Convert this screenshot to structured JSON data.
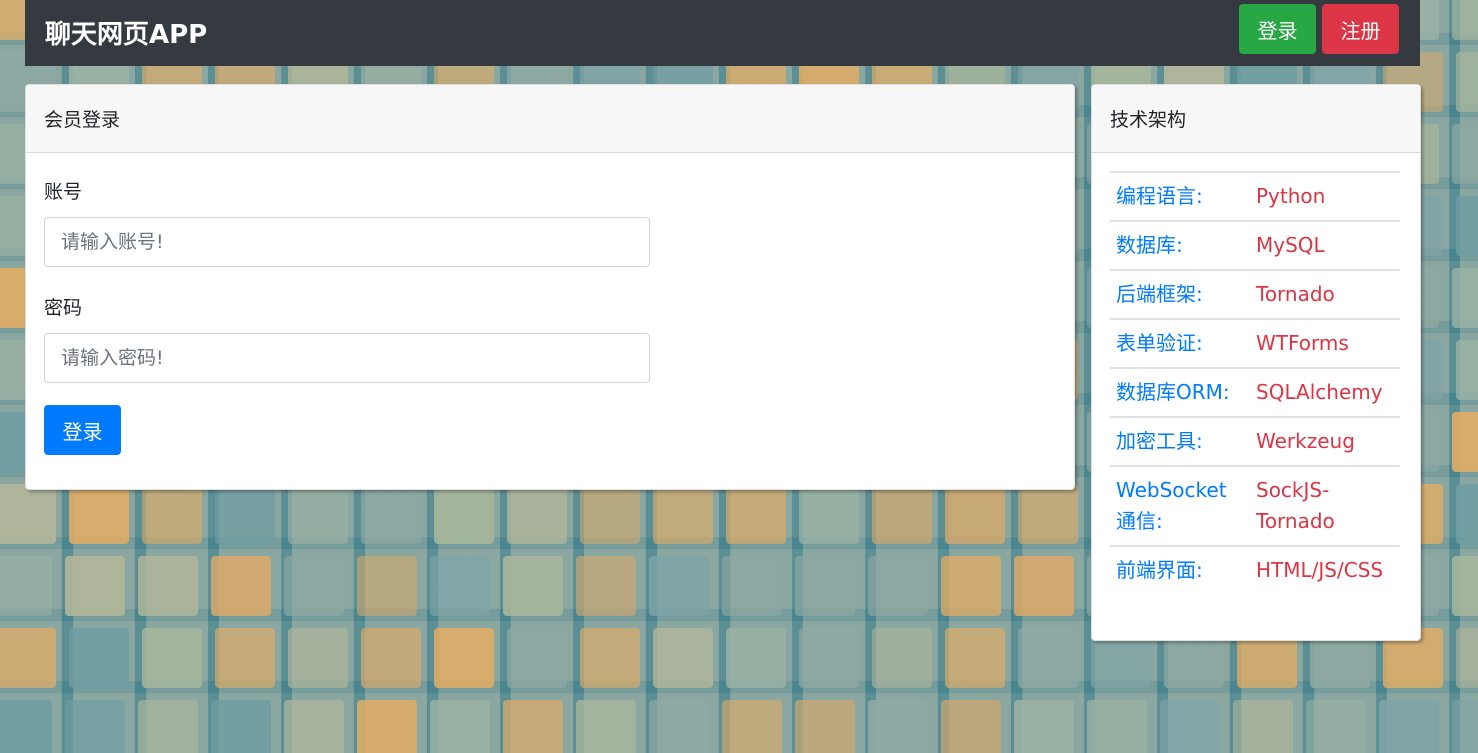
{
  "navbar": {
    "brand": "聊天网页APP",
    "login_label": "登录",
    "register_label": "注册"
  },
  "login_card": {
    "title": "会员登录",
    "account_label": "账号",
    "account_placeholder": "请输入账号!",
    "password_label": "密码",
    "password_placeholder": "请输入密码!",
    "submit_label": "登录"
  },
  "tech_card": {
    "title": "技术架构",
    "rows": [
      {
        "key": "编程语言:",
        "value": "Python"
      },
      {
        "key": "数据库:",
        "value": "MySQL"
      },
      {
        "key": "后端框架:",
        "value": "Tornado"
      },
      {
        "key": "表单验证:",
        "value": "WTForms"
      },
      {
        "key": "数据库ORM:",
        "value": "SQLAlchemy"
      },
      {
        "key": "加密工具:",
        "value": "Werkzeug"
      },
      {
        "key": "WebSocket通信:",
        "value": "SockJS-Tornado"
      },
      {
        "key": "前端界面:",
        "value": "HTML/JS/CSS"
      }
    ]
  },
  "colors": {
    "navbar_bg": "#343a40",
    "login_button": "#28a745",
    "register_button": "#dc3545",
    "primary": "#007bff",
    "tech_value": "#dc3545",
    "background": "#5e99a3"
  }
}
